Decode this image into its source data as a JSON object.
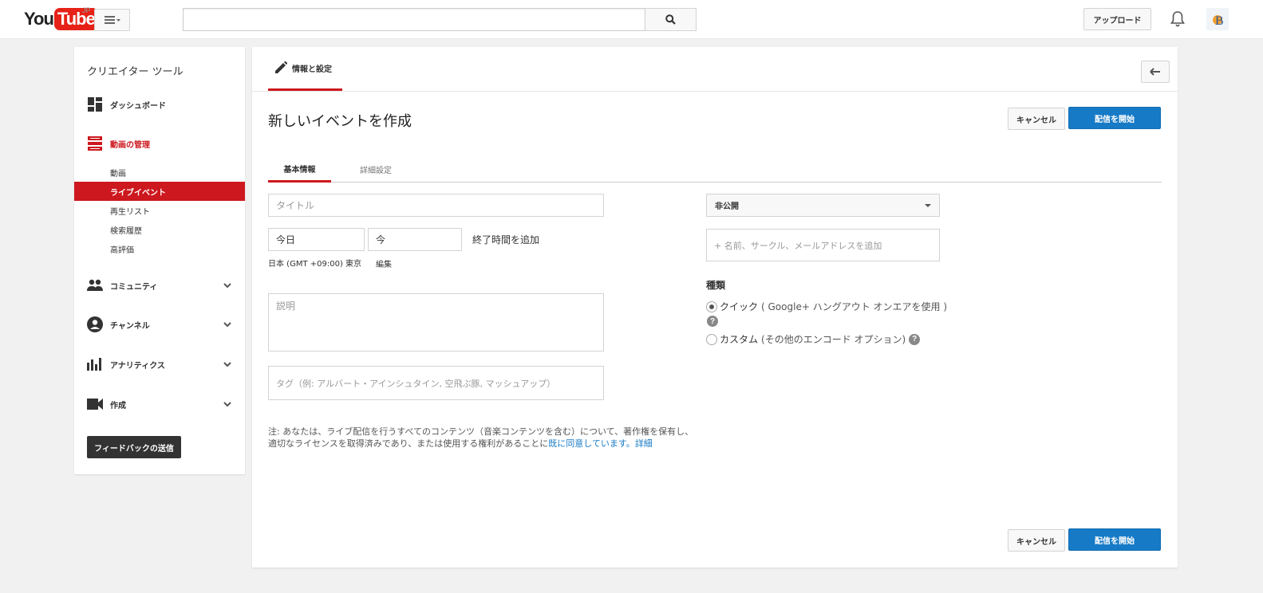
{
  "header": {
    "logo_you": "You",
    "logo_tube": "Tube",
    "logo_region": "JP",
    "search_placeholder": "",
    "upload_label": "アップロード"
  },
  "sidebar": {
    "title": "クリエイター ツール",
    "sections": [
      {
        "label": "ダッシュボード",
        "icon": "dashboard-icon"
      },
      {
        "label": "動画の管理",
        "icon": "video-manager-icon",
        "active": true
      },
      {
        "label": "コミュニティ",
        "icon": "community-icon"
      },
      {
        "label": "チャンネル",
        "icon": "channel-icon"
      },
      {
        "label": "アナリティクス",
        "icon": "analytics-icon"
      },
      {
        "label": "作成",
        "icon": "create-icon"
      }
    ],
    "sub_items": [
      {
        "label": "動画"
      },
      {
        "label": "ライブイベント",
        "active": true
      },
      {
        "label": "再生リスト"
      },
      {
        "label": "検索履歴"
      },
      {
        "label": "高評価"
      }
    ],
    "feedback_label": "フィードバックの送信"
  },
  "main": {
    "tab_label": "情報と設定",
    "title": "新しいイベントを作成",
    "cancel_label": "キャンセル",
    "start_label": "配信を開始",
    "sub_tabs": [
      "基本情報",
      "詳細設定"
    ],
    "title_placeholder": "タイトル",
    "date_value": "今日",
    "time_value": "今",
    "add_end_time": "終了時間を追加",
    "timezone": "日本 (GMT +09:00) 東京",
    "edit_label": "編集",
    "description_placeholder": "説明",
    "tags_placeholder": "タグ（例: アルバート・アインシュタイン, 空飛ぶ豚, マッシュアップ）",
    "note_text": "注: あなたは、ライブ配信を行うすべてのコンテンツ（音楽コンテンツを含む）について、著作権を保有し、適切なライセンスを取得済みであり、または使用する権利があることに",
    "note_link": "既に同意しています。",
    "note_more": "詳細",
    "privacy_value": "非公開",
    "share_placeholder": "+ 名前、サークル、メールアドレスを追加",
    "type_heading": "種類",
    "type_quick": "クイック",
    "type_quick_detail": "( Google+ ハングアウト オンエアを使用 )",
    "type_custom": "カスタム",
    "type_custom_detail": "(その他のエンコード オプション)"
  },
  "colors": {
    "brand_red": "#cc181e",
    "primary_blue": "#167ac6"
  }
}
